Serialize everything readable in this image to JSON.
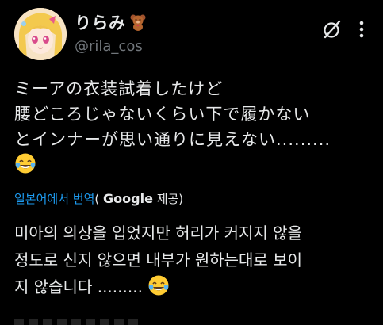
{
  "user": {
    "display_name": "りらみ",
    "name_emoji": "bear-emoji",
    "handle": "@rila_cos",
    "avatar": "avatar-image"
  },
  "actions": {
    "grok_icon": "grok-slash-circle-icon",
    "more_icon": "more-vertical-icon"
  },
  "tweet": {
    "lines": [
      "ミーアの衣装試着したけど",
      "腰どころじゃないくらい下で履かない",
      "とインナーが思い通りに見えない........."
    ],
    "emoji": "face-with-tears-of-joy-emoji"
  },
  "translation": {
    "link_label": "일본어에서 번역",
    "paren_open": "(",
    "provider": "Google",
    "provider_suffix": " 제공)",
    "lines": [
      "미아의 의상을 입었지만 허리가 커지지 않을",
      "정도로 신지 않으면 내부가 원하는대로 보이",
      "지 않습니다 ......... "
    ],
    "emoji": "face-with-tears-of-joy-emoji"
  },
  "colors": {
    "background": "#000000",
    "text": "#e7e9ea",
    "secondary": "#71767b",
    "link": "#1d9bf0"
  }
}
